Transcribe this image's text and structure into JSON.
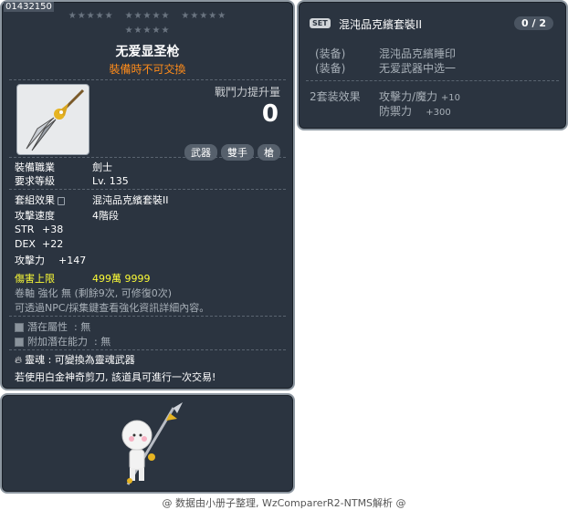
{
  "item": {
    "id": "01432150",
    "name": "无爱显圣枪",
    "trade_notice": "裝備時不可交換",
    "power_label": "戰鬥力提升量",
    "power_value": "0",
    "tags": [
      "武器",
      "雙手",
      "槍"
    ],
    "job_label": "裝備職業",
    "job_value": "劍士",
    "level_label": "要求等級",
    "level_value": "Lv. 135",
    "set_label": "套組效果",
    "set_value": "混沌品克繽套裝II",
    "speed_label": "攻擊速度",
    "speed_value": "4階段",
    "stats": [
      {
        "label": "STR",
        "value": "+38"
      },
      {
        "label": "DEX",
        "value": "+22"
      },
      {
        "label": "攻擊力",
        "value": "+147"
      }
    ],
    "damage_cap_label": "傷害上限",
    "damage_cap_value": "499萬 9999",
    "scroll_text": "卷軸 強化 無 (剩餘9次, 可修復0次)",
    "enhance_text": "可透過NPC/採集鍵查看強化資訊詳細內容。",
    "potential_label": "潛在屬性",
    "potential_value": "無",
    "add_potential_label": "附加潛在能力",
    "add_potential_value": "無",
    "soul_label": "靈魂",
    "soul_value": "可變換為靈魂武器",
    "platinum_text": "若使用白金神奇剪刀, 該道具可進行一次交易!"
  },
  "set": {
    "badge": "SET",
    "name": "混沌品克繽套裝II",
    "count": "0 / 2",
    "pieces": [
      {
        "label": "(装备)",
        "value": "混沌品克繽睡印"
      },
      {
        "label": "(装备)",
        "value": "无爱武器中选一"
      }
    ],
    "bonus_label": "2套装效果",
    "bonus_lines": [
      {
        "label": "攻擊力/魔力",
        "value": "+10"
      },
      {
        "label": "防禦力",
        "value": "+300"
      }
    ]
  },
  "footer": "@ 数据由小册子整理, WzComparerR2-NTMS解析 @",
  "colors": {
    "panel_bg": "#2b3440",
    "trade_notice": "#ff8c1a",
    "damage_cap": "#fbfb36"
  }
}
